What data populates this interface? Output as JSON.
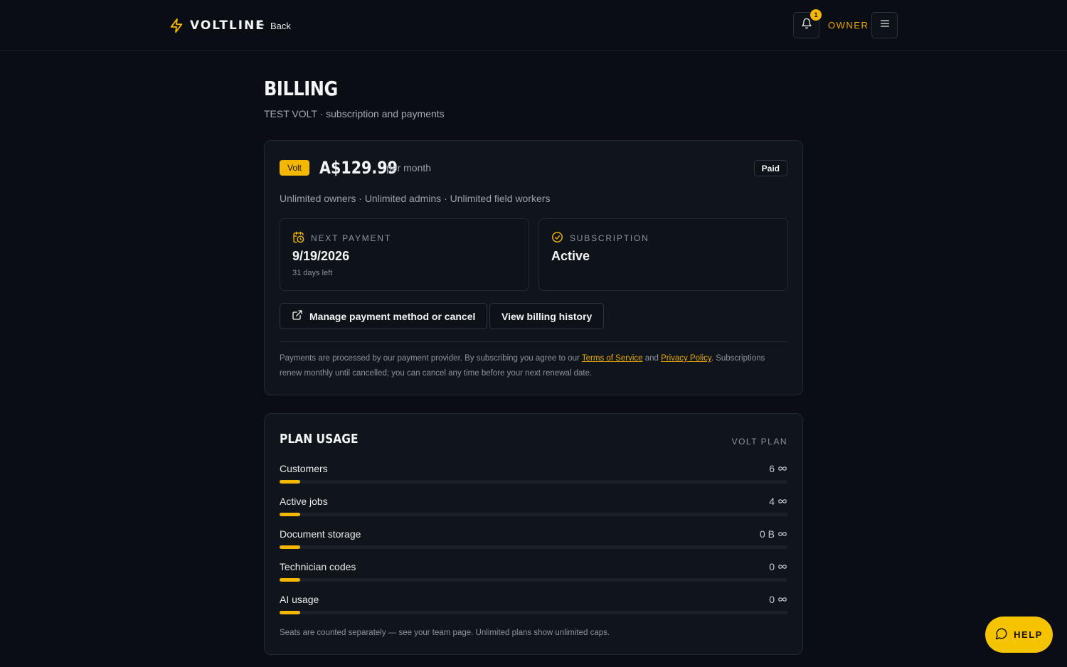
{
  "header": {
    "brand": "VOLTLINE",
    "back_label": "Back",
    "notification_count": "1",
    "role": "OWNER"
  },
  "page": {
    "title": "BILLING",
    "subtitle": "TEST VOLT · subscription and payments"
  },
  "plan": {
    "badge": "Volt",
    "price": "A$129.99",
    "period": "per month",
    "status_badge": "Paid",
    "features": "Unlimited owners · Unlimited admins · Unlimited field workers",
    "next_payment": {
      "label": "NEXT PAYMENT",
      "value": "9/19/2026",
      "sub": "31 days left"
    },
    "subscription": {
      "label": "SUBSCRIPTION",
      "value": "Active"
    },
    "manage_button": "Manage payment method or cancel",
    "history_button": "View billing history",
    "legal": {
      "before": "Payments are processed by our payment provider. By subscribing you agree to our ",
      "terms": "Terms of Service",
      "middle": " and ",
      "privacy": "Privacy Policy",
      "after": ". Subscriptions renew monthly until cancelled; you can cancel any time before your next renewal date."
    }
  },
  "usage": {
    "title": "PLAN USAGE",
    "plan_label": "VOLT PLAN",
    "items": [
      {
        "label": "Customers",
        "value": "6",
        "fill": 0.04
      },
      {
        "label": "Active jobs",
        "value": "4",
        "fill": 0.04
      },
      {
        "label": "Document storage",
        "value": "0 B",
        "fill": 0.04
      },
      {
        "label": "Technician codes",
        "value": "0",
        "fill": 0.04
      },
      {
        "label": "AI usage",
        "value": "0",
        "fill": 0.04
      }
    ],
    "note": "Seats are counted separately — see your team page. Unlimited plans show unlimited caps."
  },
  "help": {
    "label": "HELP"
  },
  "colors": {
    "accent": "#f5b800",
    "background": "#0a0e14",
    "card": "#10151c"
  }
}
